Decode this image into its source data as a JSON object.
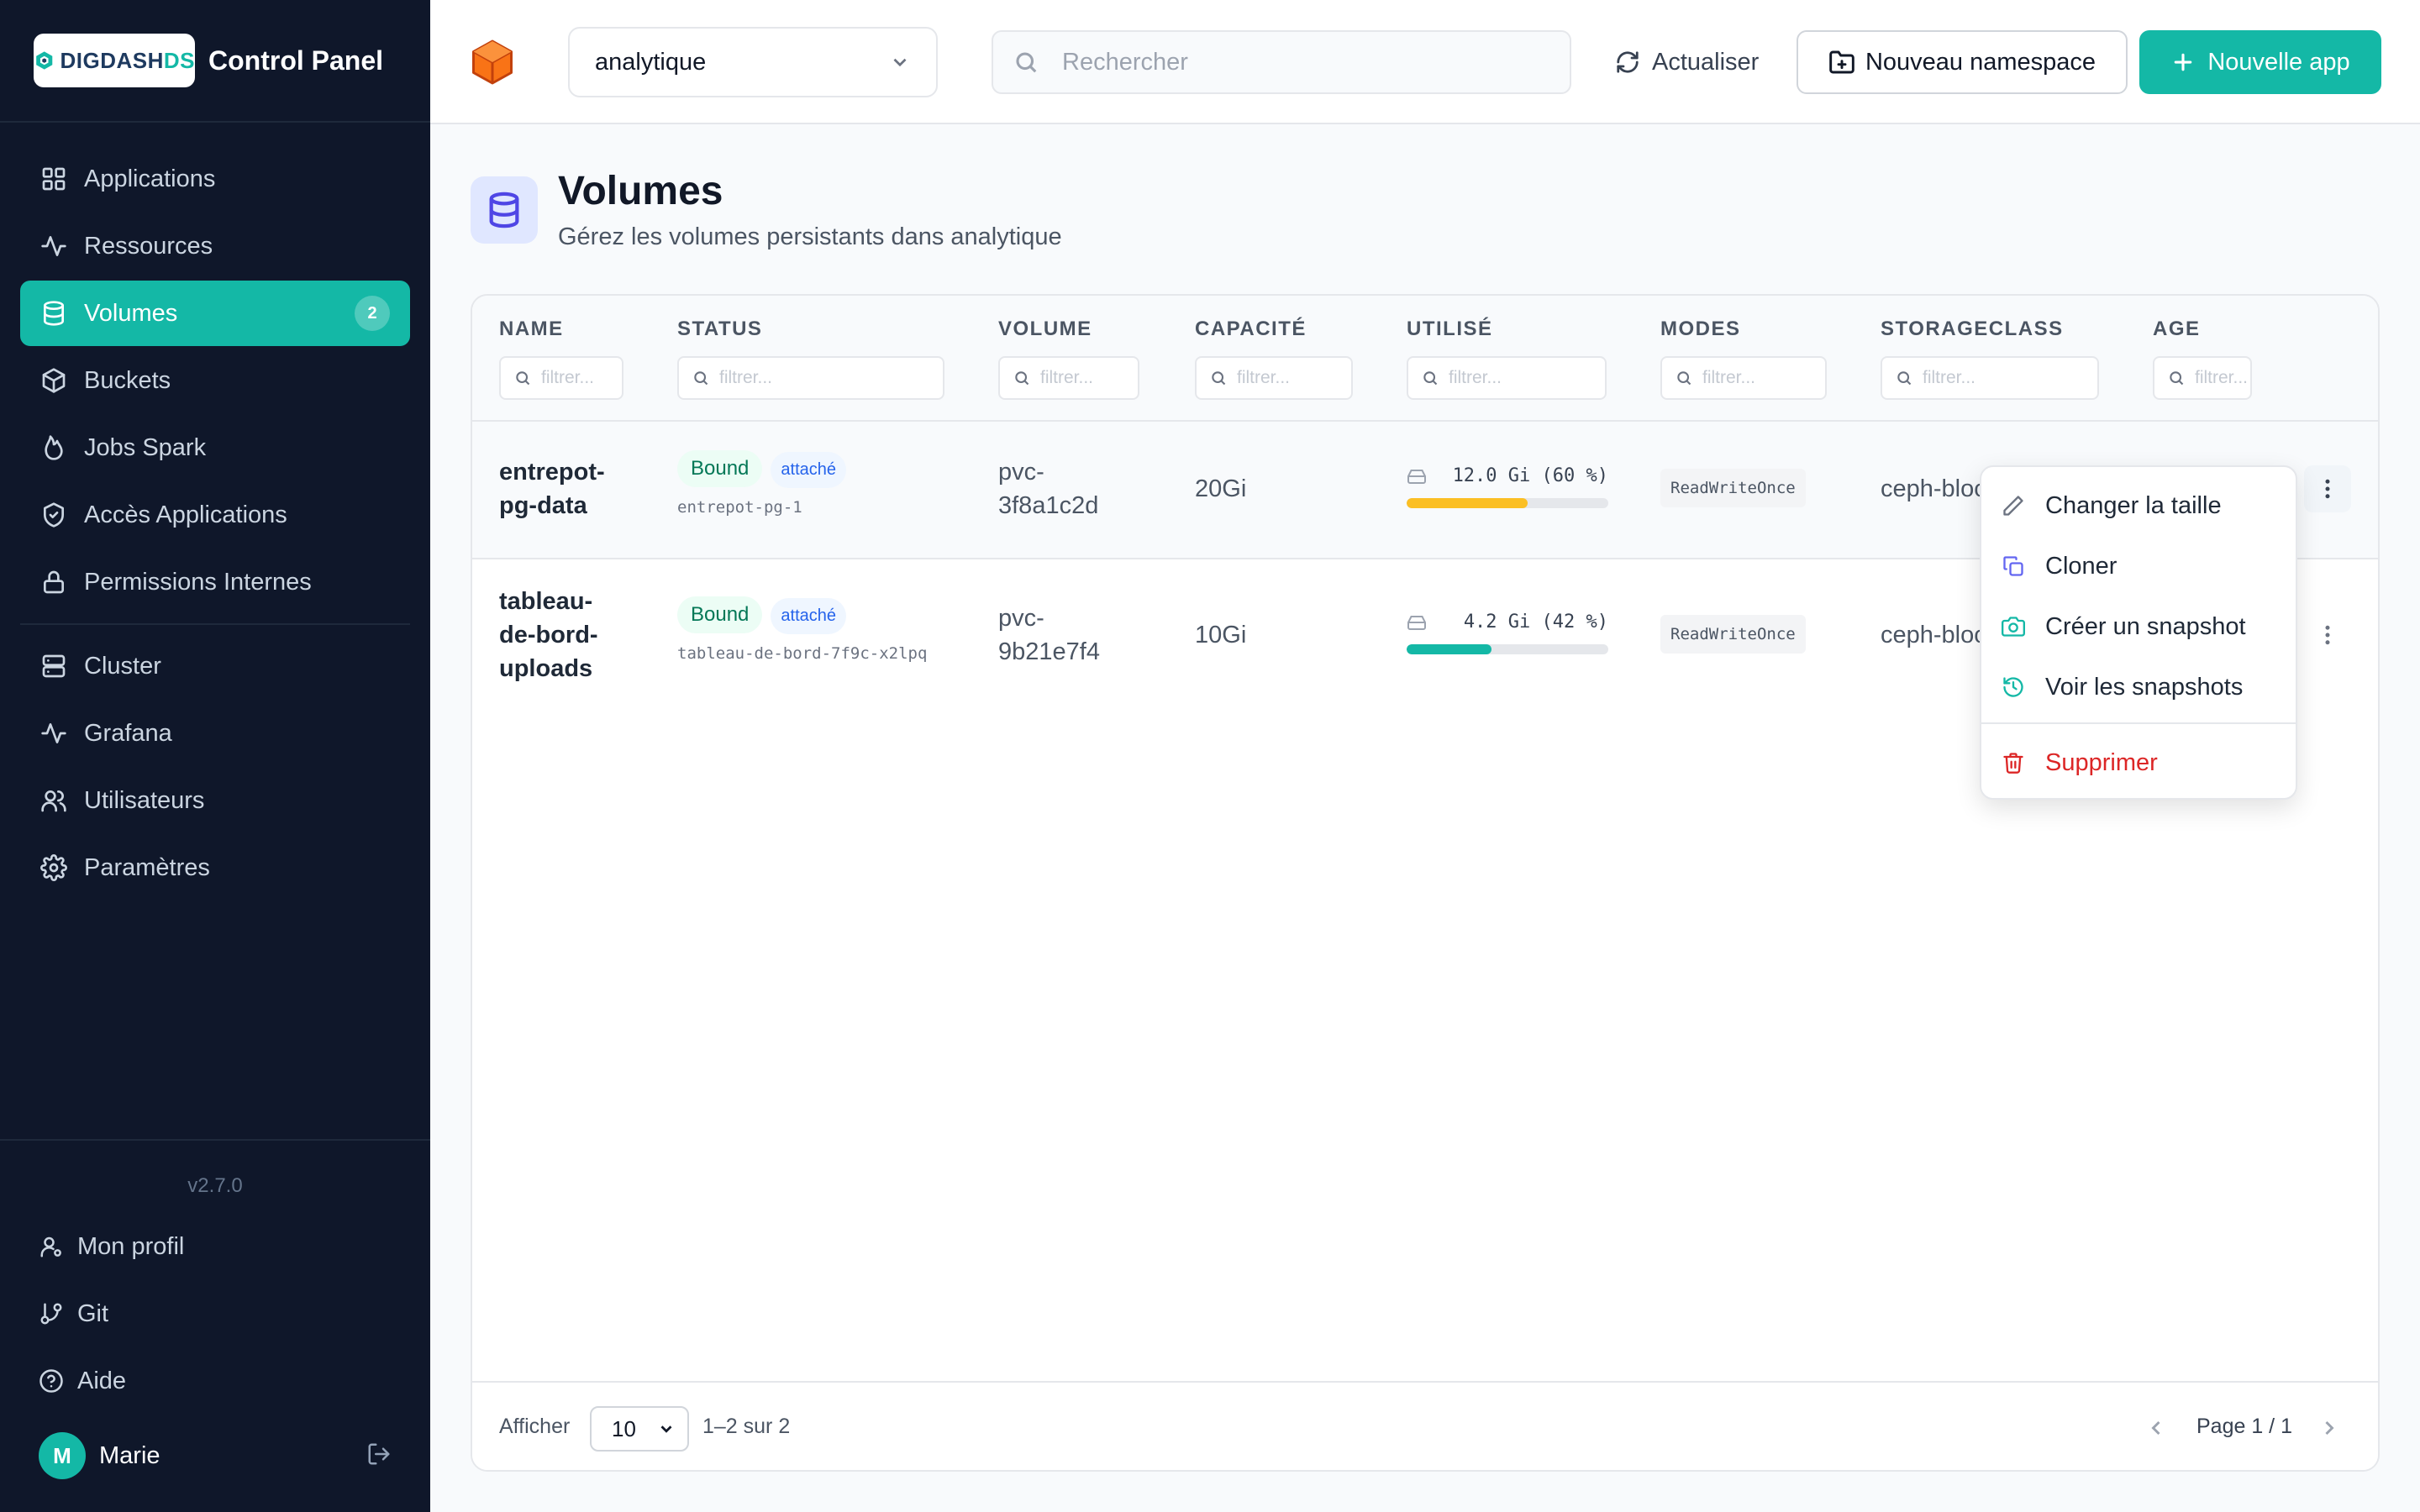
{
  "brand": {
    "logo_main": "DIGDASH",
    "logo_suffix": "DS",
    "title": "Control Panel"
  },
  "sidebar": {
    "items": [
      {
        "label": "Applications",
        "icon": "grid-icon"
      },
      {
        "label": "Ressources",
        "icon": "activity-icon"
      },
      {
        "label": "Volumes",
        "icon": "database-icon",
        "badge": "2",
        "active": true
      },
      {
        "label": "Buckets",
        "icon": "box-icon"
      },
      {
        "label": "Jobs Spark",
        "icon": "flame-icon"
      },
      {
        "label": "Accès Applications",
        "icon": "shield-icon"
      },
      {
        "label": "Permissions Internes",
        "icon": "lock-icon"
      },
      {
        "label": "Cluster",
        "icon": "server-icon"
      },
      {
        "label": "Grafana",
        "icon": "activity-icon"
      },
      {
        "label": "Utilisateurs",
        "icon": "users-icon"
      },
      {
        "label": "Paramètres",
        "icon": "gear-icon"
      }
    ],
    "version": "v2.7.0",
    "footer": [
      {
        "label": "Mon profil",
        "icon": "user-icon"
      },
      {
        "label": "Git",
        "icon": "git-branch-icon"
      },
      {
        "label": "Aide",
        "icon": "help-icon"
      }
    ],
    "user": {
      "initial": "M",
      "name": "Marie"
    }
  },
  "topbar": {
    "namespace": "analytique",
    "search_placeholder": "Rechercher",
    "refresh_label": "Actualiser",
    "new_namespace_label": "Nouveau namespace",
    "new_app_label": "Nouvelle app"
  },
  "page": {
    "title": "Volumes",
    "subtitle": "Gérez les volumes persistants dans analytique"
  },
  "table": {
    "columns": [
      "NAME",
      "STATUS",
      "VOLUME",
      "CAPACITÉ",
      "UTILISÉ",
      "MODES",
      "STORAGECLASS",
      "AGE"
    ],
    "filter_placeholder": "filtrer...",
    "rows": [
      {
        "name": "entrepot-pg-data",
        "status": "Bound",
        "attach": "attaché",
        "pod": "entrepot-pg-1",
        "volume": "pvc-3f8a1c2d",
        "capacity": "20Gi",
        "used_label": "12.0 Gi (60 %)",
        "used_pct": 60,
        "bar_color": "#fbbf24",
        "mode": "ReadWriteOnce",
        "storageclass": "ceph-block"
      },
      {
        "name": "tableau-de-bord-uploads",
        "status": "Bound",
        "attach": "attaché",
        "pod": "tableau-de-bord-7f9c-x2lpq",
        "volume": "pvc-9b21e7f4",
        "capacity": "10Gi",
        "used_label": "4.2 Gi (42 %)",
        "used_pct": 42,
        "bar_color": "#14b8a6",
        "mode": "ReadWriteOnce",
        "storageclass": "ceph-block"
      }
    ]
  },
  "pagination": {
    "show_label": "Afficher",
    "page_size": "10",
    "range": "1–2 sur 2",
    "page": "Page 1 / 1"
  },
  "context_menu": {
    "items": [
      {
        "label": "Changer la taille",
        "icon": "pencil-icon"
      },
      {
        "label": "Cloner",
        "icon": "copy-icon"
      },
      {
        "label": "Créer un snapshot",
        "icon": "camera-icon"
      },
      {
        "label": "Voir les snapshots",
        "icon": "history-icon"
      },
      {
        "label": "Supprimer",
        "icon": "trash-icon"
      }
    ]
  }
}
